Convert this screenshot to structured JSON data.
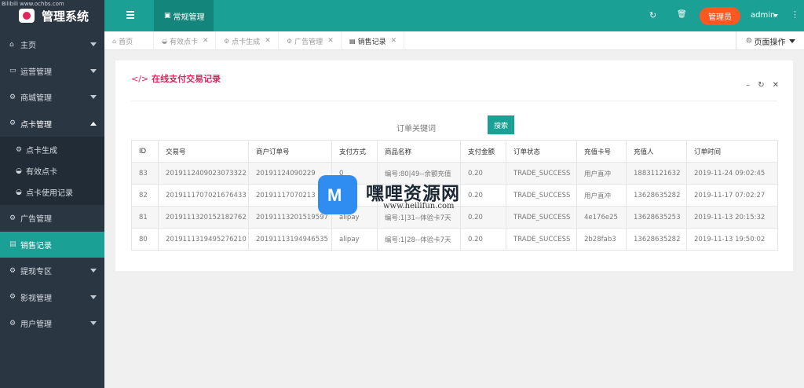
{
  "brand": {
    "small_text": "Bilibili  www.ochbs.com",
    "title": "管理系统"
  },
  "sidebar": {
    "items": [
      {
        "label": "主页",
        "icon": "home-icon"
      },
      {
        "label": "运营管理",
        "icon": "window-icon"
      },
      {
        "label": "商城管理",
        "icon": "gears-icon"
      },
      {
        "label": "点卡管理",
        "icon": "gears-icon"
      },
      {
        "label": "广告管理",
        "icon": "gears-icon"
      },
      {
        "label": "销售记录",
        "icon": "file-icon"
      },
      {
        "label": "提现专区",
        "icon": "gears-icon"
      },
      {
        "label": "影视管理",
        "icon": "gears-icon"
      },
      {
        "label": "用户管理",
        "icon": "gears-icon"
      }
    ],
    "sub_items": [
      {
        "label": "点卡生成",
        "icon": "gears-icon"
      },
      {
        "label": "有效点卡",
        "icon": "dashboard-icon"
      },
      {
        "label": "点卡使用记录",
        "icon": "dashboard-icon"
      }
    ]
  },
  "topbar": {
    "current_tab": "常规管理",
    "role_badge": "管理员",
    "user": "admin"
  },
  "tabs": [
    {
      "label": "首页",
      "icon": "home-icon"
    },
    {
      "label": "有效点卡",
      "icon": "dashboard-icon"
    },
    {
      "label": "点卡生成",
      "icon": "gears-icon"
    },
    {
      "label": "广告管理",
      "icon": "gears-icon"
    },
    {
      "label": "销售记录",
      "icon": "file-icon"
    }
  ],
  "page_ops": "页面操作",
  "panel": {
    "title": "在线支付交易记录",
    "search_label": "订单关键词",
    "search_button": "搜索"
  },
  "table": {
    "headers": [
      "ID",
      "交易号",
      "商户订单号",
      "支付方式",
      "商品名称",
      "支付金额",
      "订单状态",
      "充值卡号",
      "充值人",
      "订单时间"
    ],
    "rows": [
      [
        "83",
        "2019112409023073322",
        "20191124090229",
        "0",
        "编号:80|49--余额充值",
        "0.20",
        "TRADE_SUCCESS",
        "用户直冲",
        "18831121632",
        "2019-11-24 09:02:45"
      ],
      [
        "82",
        "2019111707021676433",
        "20191117070213",
        "",
        "",
        "0.20",
        "TRADE_SUCCESS",
        "用户直冲",
        "13628635282",
        "2019-11-17 07:02:27"
      ],
      [
        "81",
        "2019111320152182762",
        "20191113201519597",
        "alipay",
        "编号:1|31--体验卡7天",
        "0.20",
        "TRADE_SUCCESS",
        "4e176e25",
        "13628635253",
        "2019-11-13 20:15:32"
      ],
      [
        "80",
        "2019111319495276210",
        "20191113194946535",
        "alipay",
        "编号:1|28--体验卡7天",
        "0.20",
        "TRADE_SUCCESS",
        "2b28fab3",
        "13628635282",
        "2019-11-13 19:50:02"
      ]
    ]
  },
  "watermark": {
    "title": "嘿哩资源网",
    "url": "www.heilifun.com"
  },
  "colors": {
    "accent": "#1aa094",
    "sidebar": "#2b3643",
    "title": "#e0245e",
    "badge": "#ff5722"
  }
}
